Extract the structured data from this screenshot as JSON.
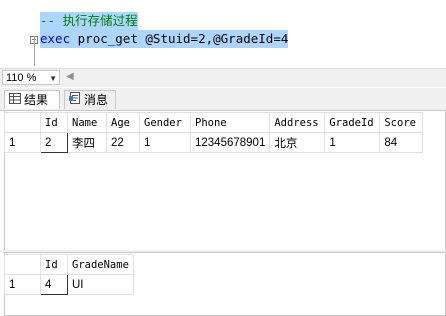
{
  "editor": {
    "comment": "-- 执行存储过程",
    "exec_keyword": "exec",
    "proc_name": "proc_get",
    "params": "@Stuid=2,@GradeId=4"
  },
  "zoom": {
    "value": "110 %"
  },
  "tabs": [
    {
      "label": "结果",
      "icon": "grid-icon"
    },
    {
      "label": "消息",
      "icon": "message-icon"
    }
  ],
  "results": {
    "table1": {
      "columns": [
        "Id",
        "Name",
        "Age",
        "Gender",
        "Phone",
        "Address",
        "GradeId",
        "Score"
      ],
      "rows": [
        {
          "num": "1",
          "cells": [
            "2",
            "李四",
            "22",
            "1",
            "12345678901",
            "北京",
            "1",
            "84"
          ]
        }
      ]
    },
    "table2": {
      "columns": [
        "Id",
        "GradeName"
      ],
      "rows": [
        {
          "num": "1",
          "cells": [
            "4",
            "UI"
          ]
        }
      ]
    }
  }
}
